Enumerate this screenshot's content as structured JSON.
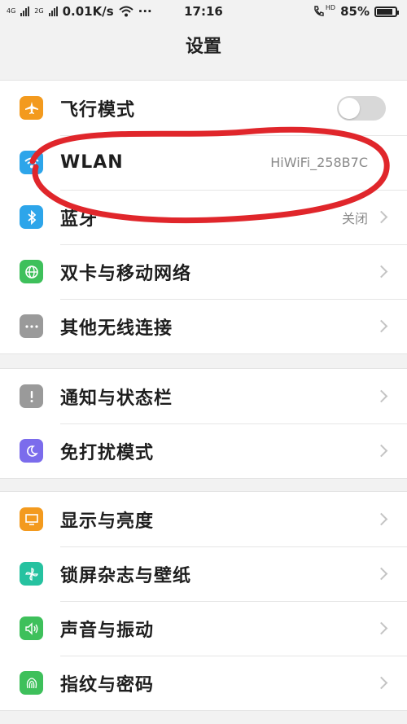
{
  "status_bar": {
    "left_tag_1": "4G",
    "left_tag_2": "2G",
    "speed": "0.01K/s",
    "dots": "···",
    "time": "17:16",
    "hd": "HD",
    "battery": "85%",
    "battery_level": 0.85
  },
  "header": {
    "title": "设置"
  },
  "groups": [
    {
      "items": [
        {
          "label": "飞行模式",
          "icon": "airplane-icon",
          "color": "#f39a1e",
          "toggle_on": false
        },
        {
          "label": "WLAN",
          "icon": "wifi-icon",
          "color": "#2da5ea",
          "value": "HiWiFi_258B7C"
        },
        {
          "label": "蓝牙",
          "icon": "bluetooth-icon",
          "color": "#2da5ea",
          "value": "关闭"
        },
        {
          "label": "双卡与移动网络",
          "icon": "globe-icon",
          "color": "#3ec05b"
        },
        {
          "label": "其他无线连接",
          "icon": "more-dots-icon",
          "color": "#9a9a9a"
        }
      ]
    },
    {
      "items": [
        {
          "label": "通知与状态栏",
          "icon": "exclamation-icon",
          "color": "#9a9a9a"
        },
        {
          "label": "免打扰模式",
          "icon": "moon-icon",
          "color": "#7b6cec"
        }
      ]
    },
    {
      "items": [
        {
          "label": "显示与亮度",
          "icon": "monitor-icon",
          "color": "#f39a1e"
        },
        {
          "label": "锁屏杂志与壁纸",
          "icon": "pinwheel-icon",
          "color": "#26c2a0"
        },
        {
          "label": "声音与振动",
          "icon": "speaker-icon",
          "color": "#3ec05b"
        },
        {
          "label": "指纹与密码",
          "icon": "fingerprint-icon",
          "color": "#3ec05b"
        }
      ]
    }
  ],
  "annotation": {
    "color": "#e0262b"
  }
}
